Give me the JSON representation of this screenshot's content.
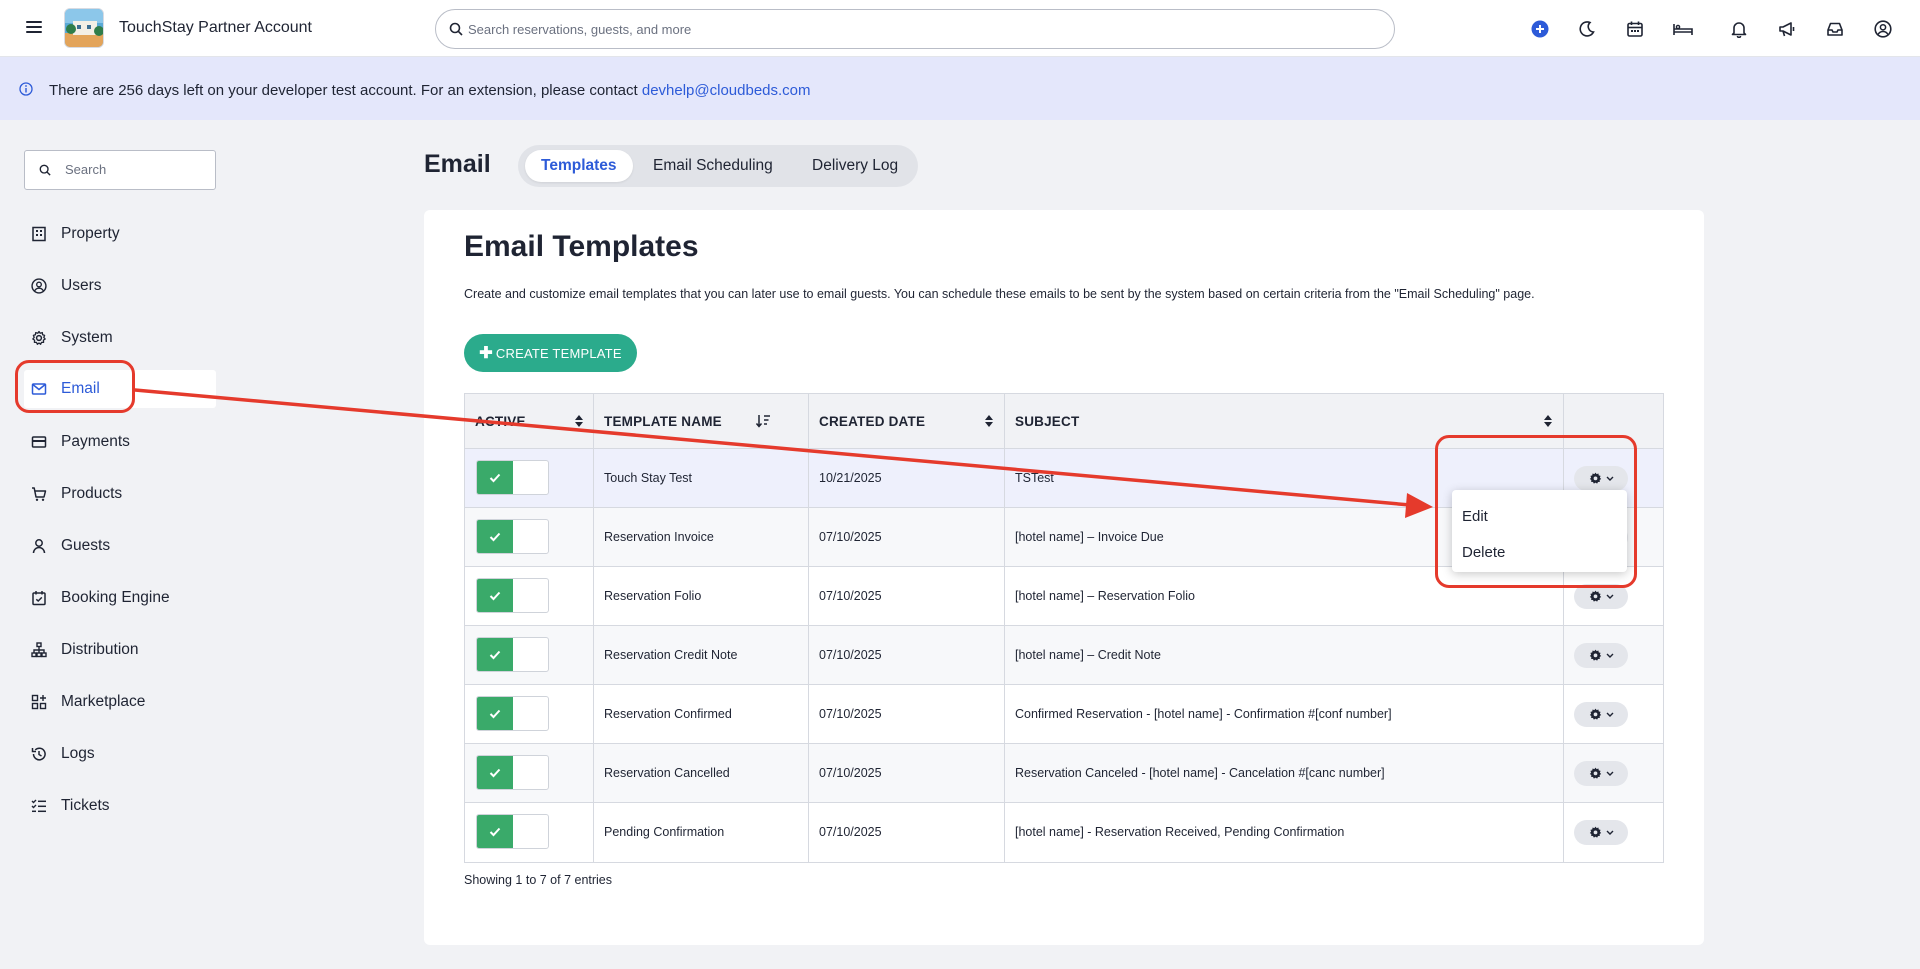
{
  "app": {
    "title": "TouchStay Partner Account",
    "search_placeholder": "Search reservations, guests, and more",
    "icons": [
      "plus-circle-icon",
      "moon-icon",
      "calendar-icon",
      "bed-icon",
      "bell-icon",
      "megaphone-icon",
      "inbox-icon",
      "user-circle-icon"
    ]
  },
  "banner": {
    "text": "There are 256 days left on your developer test account. For an extension, please contact ",
    "link": "devhelp@cloudbeds.com"
  },
  "sidebar": {
    "search_placeholder": "Search",
    "items": [
      {
        "label": "Property",
        "icon": "building-icon"
      },
      {
        "label": "Users",
        "icon": "user-circle-icon"
      },
      {
        "label": "System",
        "icon": "gear-icon"
      },
      {
        "label": "Email",
        "icon": "envelope-icon",
        "active": true
      },
      {
        "label": "Payments",
        "icon": "credit-card-icon"
      },
      {
        "label": "Products",
        "icon": "cart-icon"
      },
      {
        "label": "Guests",
        "icon": "person-icon"
      },
      {
        "label": "Booking Engine",
        "icon": "calendar-check-icon"
      },
      {
        "label": "Distribution",
        "icon": "sitemap-icon"
      },
      {
        "label": "Marketplace",
        "icon": "apps-icon"
      },
      {
        "label": "Logs",
        "icon": "history-icon"
      },
      {
        "label": "Tickets",
        "icon": "checklist-icon"
      }
    ]
  },
  "page": {
    "title": "Email",
    "tabs": [
      {
        "label": "Templates",
        "active": true
      },
      {
        "label": "Email Scheduling"
      },
      {
        "label": "Delivery Log"
      }
    ]
  },
  "card": {
    "title": "Email Templates",
    "description": "Create and customize email templates that you can later use to email guests. You can schedule these emails to be sent by the system based on certain criteria from the \"Email Scheduling\" page.",
    "create_button": "CREATE TEMPLATE"
  },
  "table": {
    "columns": [
      "ACTIVE",
      "TEMPLATE NAME",
      "CREATED DATE",
      "SUBJECT"
    ],
    "rows": [
      {
        "active": true,
        "name": "Touch Stay Test",
        "created": "10/21/2025",
        "subject": "TSTest"
      },
      {
        "active": true,
        "name": "Reservation Invoice",
        "created": "07/10/2025",
        "subject": "[hotel name] – Invoice Due"
      },
      {
        "active": true,
        "name": "Reservation Folio",
        "created": "07/10/2025",
        "subject": "[hotel name] – Reservation Folio"
      },
      {
        "active": true,
        "name": "Reservation Credit Note",
        "created": "07/10/2025",
        "subject": "[hotel name] – Credit Note"
      },
      {
        "active": true,
        "name": "Reservation Confirmed",
        "created": "07/10/2025",
        "subject": "Confirmed Reservation - [hotel name] - Confirmation #[conf number]"
      },
      {
        "active": true,
        "name": "Reservation Cancelled",
        "created": "07/10/2025",
        "subject": "Reservation Canceled - [hotel name] - Cancelation #[canc number]"
      },
      {
        "active": true,
        "name": "Pending Confirmation",
        "created": "07/10/2025",
        "subject": "[hotel name] - Reservation Received, Pending Confirmation"
      }
    ],
    "footer": "Showing 1 to 7 of 7 entries"
  },
  "dropdown": {
    "items": [
      "Edit",
      "Delete"
    ]
  },
  "colors": {
    "accent": "#2d5bd8",
    "create_button": "#2bab8c",
    "toggle_on": "#3aaa6a",
    "annotation": "#e53a2c",
    "banner_bg": "#e4e7fb"
  }
}
